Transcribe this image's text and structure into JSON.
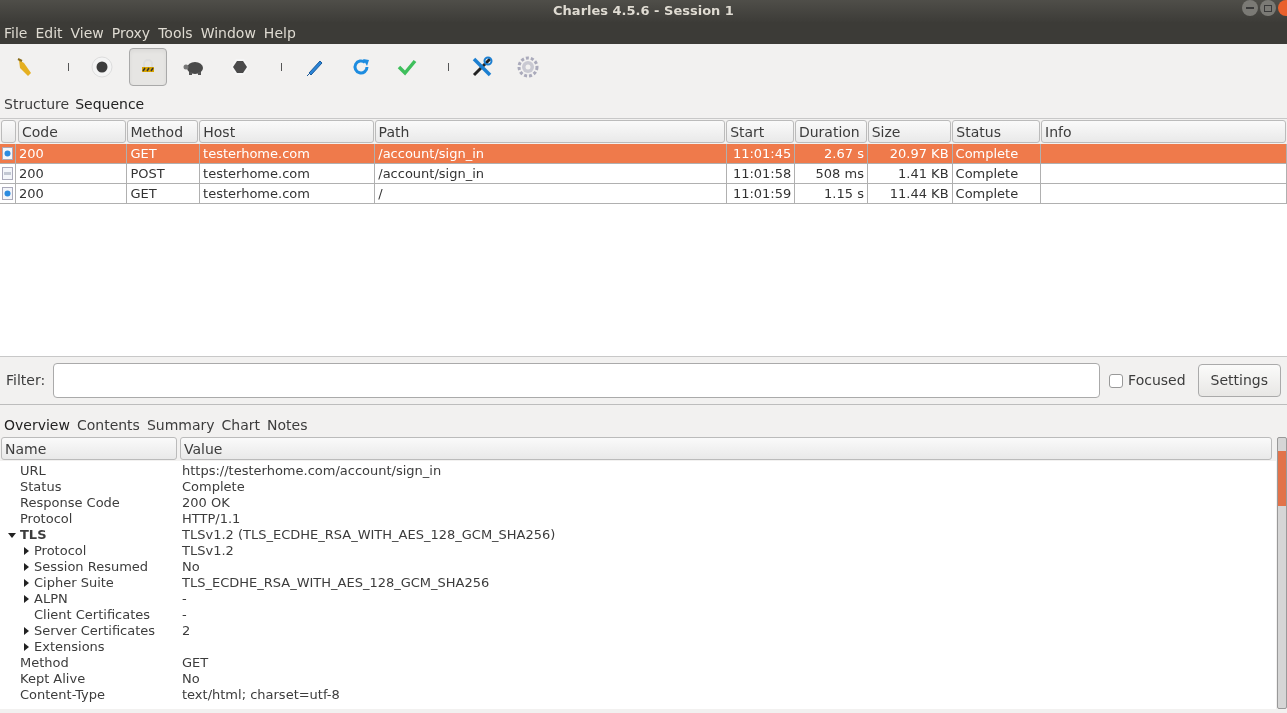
{
  "window": {
    "title": "Charles 4.5.6 - Session 1"
  },
  "menu": [
    "File",
    "Edit",
    "View",
    "Proxy",
    "Tools",
    "Window",
    "Help"
  ],
  "toolbar": [
    {
      "kind": "button",
      "selected": false
    },
    {
      "kind": "separator"
    },
    {
      "kind": "button",
      "selected": false
    },
    {
      "kind": "button",
      "selected": true
    },
    {
      "kind": "button",
      "selected": false
    },
    {
      "kind": "button",
      "selected": false
    },
    {
      "kind": "separator"
    },
    {
      "kind": "button",
      "selected": false
    },
    {
      "kind": "button",
      "selected": false
    },
    {
      "kind": "button",
      "selected": false
    },
    {
      "kind": "separator"
    },
    {
      "kind": "button",
      "selected": false
    },
    {
      "kind": "button",
      "selected": false
    }
  ],
  "view_tabs": [
    {
      "label": "Structure",
      "selected": false
    },
    {
      "label": "Sequence",
      "selected": true
    }
  ],
  "table": {
    "columns": [
      "Code",
      "Method",
      "Host",
      "Path",
      "Start",
      "Duration",
      "Size",
      "Status",
      "Info"
    ],
    "rows": [
      {
        "kind": "html",
        "selected": true,
        "cells": [
          "200",
          "GET",
          "testerhome.com",
          "/account/sign_in",
          "11:01:45",
          "2.67 s",
          "20.97 KB",
          "Complete",
          ""
        ]
      },
      {
        "kind": "js",
        "selected": false,
        "cells": [
          "200",
          "POST",
          "testerhome.com",
          "/account/sign_in",
          "11:01:58",
          "508 ms",
          "1.41 KB",
          "Complete",
          ""
        ]
      },
      {
        "kind": "html",
        "selected": false,
        "cells": [
          "200",
          "GET",
          "testerhome.com",
          "/",
          "11:01:59",
          "1.15 s",
          "11.44 KB",
          "Complete",
          ""
        ]
      }
    ]
  },
  "filter": {
    "label": "Filter:",
    "focused": {
      "label": "Focused",
      "checked": false
    },
    "settings_button": "Settings"
  },
  "detail_tabs": [
    {
      "label": "Overview",
      "selected": true
    },
    {
      "label": "Contents",
      "selected": false
    },
    {
      "label": "Summary",
      "selected": false
    },
    {
      "label": "Chart",
      "selected": false
    },
    {
      "label": "Notes",
      "selected": false
    }
  ],
  "overview": {
    "columns": [
      "Name",
      "Value"
    ],
    "rows": [
      {
        "name": "URL",
        "value": "https://testerhome.com/account/sign_in",
        "kind": "leaf"
      },
      {
        "name": "Status",
        "value": "Complete",
        "kind": "leaf"
      },
      {
        "name": "Response Code",
        "value": "200 OK",
        "kind": "leaf"
      },
      {
        "name": "Protocol",
        "value": "HTTP/1.1",
        "kind": "leaf"
      },
      {
        "name": "TLS",
        "value": "TLSv1.2 (TLS_ECDHE_RSA_WITH_AES_128_GCM_SHA256)",
        "kind": "branch",
        "expanded": true,
        "children": [
          {
            "name": "Protocol",
            "value": "TLSv1.2",
            "kind": "branch",
            "expanded": false
          },
          {
            "name": "Session Resumed",
            "value": "No",
            "kind": "branch",
            "expanded": false
          },
          {
            "name": "Cipher Suite",
            "value": "TLS_ECDHE_RSA_WITH_AES_128_GCM_SHA256",
            "kind": "branch",
            "expanded": false
          },
          {
            "name": "ALPN",
            "value": "-",
            "kind": "branch",
            "expanded": false
          },
          {
            "name": "Client Certificates",
            "value": "-",
            "kind": "leaf"
          },
          {
            "name": "Server Certificates",
            "value": "2",
            "kind": "branch",
            "expanded": false
          },
          {
            "name": "Extensions",
            "kind": "branch",
            "expanded": false
          }
        ]
      },
      {
        "name": "Method",
        "value": "GET",
        "kind": "leaf"
      },
      {
        "name": "Kept Alive",
        "value": "No",
        "kind": "leaf"
      },
      {
        "name": "Content-Type",
        "value": "text/html; charset=utf-8",
        "kind": "leaf"
      }
    ]
  }
}
